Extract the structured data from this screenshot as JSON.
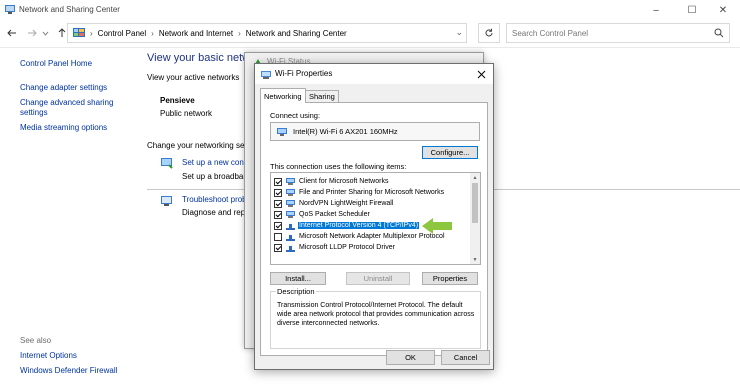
{
  "window": {
    "title": "Network and Sharing Center",
    "minimize": "–",
    "maximize": "☐",
    "close": "✕"
  },
  "address": {
    "crumbs": [
      "Control Panel",
      "Network and Internet",
      "Network and Sharing Center"
    ],
    "search_placeholder": "Search Control Panel"
  },
  "left_pane": {
    "links": [
      "Control Panel Home",
      "Change adapter settings",
      "Change advanced sharing settings",
      "Media streaming options"
    ],
    "see_also_label": "See also",
    "see_also_links": [
      "Internet Options",
      "Windows Defender Firewall"
    ]
  },
  "content": {
    "heading": "View your basic netw",
    "active_networks_label": "View your active networks",
    "network_name": "Pensieve",
    "network_type": "Public network",
    "change_settings_label": "Change your networking set",
    "tasks": [
      {
        "link": "Set up a new conn",
        "text": "Set up a broadban"
      },
      {
        "link": "Troubleshoot prob",
        "text": "Diagnose and rep"
      }
    ]
  },
  "status_dialog": {
    "title": "Wi-Fi Status"
  },
  "properties_dialog": {
    "title": "Wi-Fi Properties",
    "tabs": [
      "Networking",
      "Sharing"
    ],
    "connect_using_label": "Connect using:",
    "adapter_name": "Intel(R) Wi-Fi 6 AX201 160MHz",
    "configure_button": "Configure...",
    "items_label": "This connection uses the following items:",
    "items": [
      {
        "label": "Client for Microsoft Networks",
        "checked": true,
        "icon": "network-client-icon",
        "selected": false
      },
      {
        "label": "File and Printer Sharing for Microsoft Networks",
        "checked": true,
        "icon": "network-service-icon",
        "selected": false
      },
      {
        "label": "NordVPN LightWeight Firewall",
        "checked": true,
        "icon": "network-service-icon",
        "selected": false
      },
      {
        "label": "QoS Packet Scheduler",
        "checked": true,
        "icon": "network-service-icon",
        "selected": false
      },
      {
        "label": "Internet Protocol Version 4 (TCP/IPv4)",
        "checked": true,
        "icon": "protocol-icon",
        "selected": true
      },
      {
        "label": "Microsoft Network Adapter Multiplexor Protocol",
        "checked": false,
        "icon": "protocol-icon",
        "selected": false
      },
      {
        "label": "Microsoft LLDP Protocol Driver",
        "checked": true,
        "icon": "protocol-icon",
        "selected": false
      }
    ],
    "install_button": "Install...",
    "uninstall_button": "Uninstall",
    "properties_button": "Properties",
    "description_label": "Description",
    "description_text": "Transmission Control Protocol/Internet Protocol. The default wide area network protocol that provides communication across diverse interconnected networks.",
    "ok_button": "OK",
    "cancel_button": "Cancel"
  },
  "colors": {
    "link": "#0033a0",
    "selection": "#0078d7",
    "annotation_arrow": "#8dc63f"
  }
}
